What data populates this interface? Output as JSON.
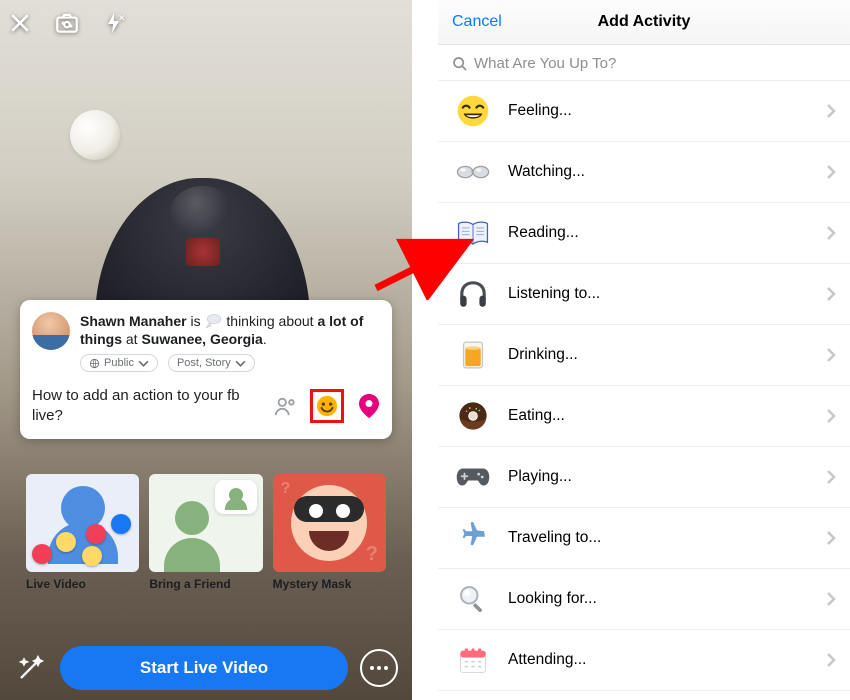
{
  "left": {
    "user_name": "Shawn Manaher",
    "status_verb": "is",
    "status_activity": "thinking about",
    "status_object": "a lot of things",
    "status_at": "at",
    "status_place": "Suwanee, Georgia",
    "audience": "Public",
    "share_to": "Post, Story",
    "question": "How to add an action to your fb live?",
    "tile1": "Live Video",
    "tile2": "Bring a Friend",
    "tile3": "Mystery Mask",
    "start_button": "Start Live Video"
  },
  "right": {
    "cancel": "Cancel",
    "title": "Add Activity",
    "search_placeholder": "What Are You Up To?",
    "items": [
      {
        "label": "Feeling..."
      },
      {
        "label": "Watching..."
      },
      {
        "label": "Reading..."
      },
      {
        "label": "Listening to..."
      },
      {
        "label": "Drinking..."
      },
      {
        "label": "Eating..."
      },
      {
        "label": "Playing..."
      },
      {
        "label": "Traveling to..."
      },
      {
        "label": "Looking for..."
      },
      {
        "label": "Attending..."
      }
    ]
  }
}
